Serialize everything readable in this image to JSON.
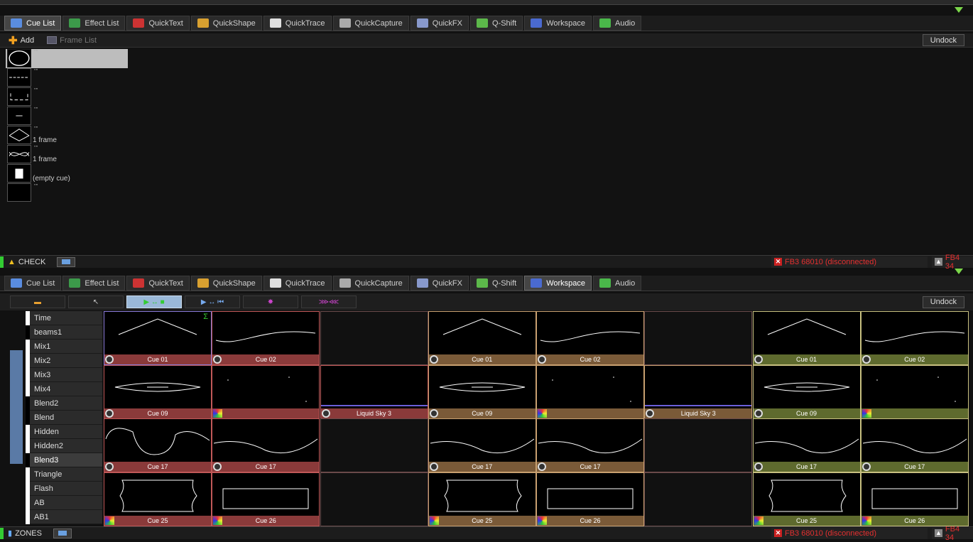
{
  "tabs": [
    {
      "label": "Cue List",
      "icon": "monitor-icon",
      "color": "#5a8de0"
    },
    {
      "label": "Effect List",
      "icon": "effect-list-icon",
      "color": "#3c9a4a"
    },
    {
      "label": "QuickText",
      "icon": "quicktext-icon",
      "color": "#cc3333"
    },
    {
      "label": "QuickShape",
      "icon": "quickshape-icon",
      "color": "#d8a030"
    },
    {
      "label": "QuickTrace",
      "icon": "quicktrace-icon",
      "color": "#e0e0e0"
    },
    {
      "label": "QuickCapture",
      "icon": "quickcapture-icon",
      "color": "#aaaaaa"
    },
    {
      "label": "QuickFX",
      "icon": "quickfx-icon",
      "color": "#8899cc"
    },
    {
      "label": "Q-Shift",
      "icon": "qshift-icon",
      "color": "#5cb84a"
    },
    {
      "label": "Workspace",
      "icon": "workspace-icon",
      "color": "#4a6ad0"
    },
    {
      "label": "Audio",
      "icon": "audio-icon",
      "color": "#4ab84a"
    }
  ],
  "top": {
    "active_tab": "Cue List",
    "toolbar": {
      "add": "Add",
      "frame_list": "Frame List",
      "undock": "Undock"
    },
    "cues": [
      {
        "label": "",
        "dots": "''''",
        "shape": "ellipse"
      },
      {
        "label": "",
        "dots": "''''",
        "shape": "dashes"
      },
      {
        "label": "",
        "dots": "''''",
        "shape": "bracket"
      },
      {
        "label": "",
        "dots": "''''",
        "shape": "minus"
      },
      {
        "label": "1 frame",
        "dots": "''''",
        "shape": "diamond"
      },
      {
        "label": "1 frame",
        "dots": "''''",
        "shape": "loop"
      },
      {
        "label": "(empty cue)",
        "dots": "",
        "shape": "doc"
      },
      {
        "label": "",
        "dots": "''''",
        "shape": "blank"
      }
    ],
    "status": {
      "check": "CHECK",
      "disconnected": "FB3 68010 (disconnected)",
      "fb4": "FB4 34"
    }
  },
  "bottom": {
    "active_tab": "Workspace",
    "undock": "Undock",
    "zones": [
      "Time",
      "beams1",
      "Mix1",
      "Mix2",
      "Mix3",
      "Mix4",
      "Blend2",
      "Blend",
      "Hidden",
      "Hidden2",
      "Blend3",
      "Triangle",
      "Flash",
      "AB",
      "AB1"
    ],
    "selected_zone": "Blend3",
    "status": {
      "zones": "ZONES",
      "disconnected": "FB3 68010 (disconnected)",
      "fb4": "FB4 34"
    },
    "group_colors": {
      "A": "#8a3a3a",
      "B": "#7a5a38",
      "C": "#5e6a2e"
    },
    "grid": [
      [
        {
          "label": "Cue 01",
          "g": "A",
          "s": "peak",
          "i": "disc",
          "sel": true
        },
        {
          "label": "Cue 02",
          "g": "A",
          "s": "wave",
          "i": "disc"
        },
        {
          "label": "",
          "g": "E"
        },
        {
          "label": "Cue 01",
          "g": "B",
          "s": "peak",
          "i": "disc"
        },
        {
          "label": "Cue 02",
          "g": "B",
          "s": "wave",
          "i": "disc"
        },
        {
          "label": "",
          "g": "E"
        },
        {
          "label": "Cue 01",
          "g": "C",
          "s": "peak",
          "i": "disc"
        },
        {
          "label": "Cue 02",
          "g": "C",
          "s": "wave",
          "i": "disc"
        }
      ],
      [
        {
          "label": "Cue 09",
          "g": "A",
          "s": "eye",
          "i": "disc"
        },
        {
          "label": "",
          "g": "A",
          "s": "dots",
          "i": "color"
        },
        {
          "label": "Liquid Sky 3",
          "g": "A",
          "s": "sky",
          "i": "disc"
        },
        {
          "label": "Cue 09",
          "g": "B",
          "s": "eye",
          "i": "disc"
        },
        {
          "label": "",
          "g": "B",
          "s": "dots",
          "i": "color"
        },
        {
          "label": "Liquid Sky 3",
          "g": "B",
          "s": "sky",
          "i": "disc"
        },
        {
          "label": "Cue 09",
          "g": "C",
          "s": "eye",
          "i": "disc"
        },
        {
          "label": "",
          "g": "C",
          "s": "dots",
          "i": "color"
        }
      ],
      [
        {
          "label": "Cue 17",
          "g": "A",
          "s": "dip",
          "i": "disc"
        },
        {
          "label": "Cue 17",
          "g": "A",
          "s": "curve",
          "i": "disc"
        },
        {
          "label": "",
          "g": "E"
        },
        {
          "label": "Cue 17",
          "g": "B",
          "s": "curve",
          "i": "disc"
        },
        {
          "label": "Cue 17",
          "g": "B",
          "s": "curve",
          "i": "disc"
        },
        {
          "label": "",
          "g": "E"
        },
        {
          "label": "Cue 17",
          "g": "C",
          "s": "curve",
          "i": "disc"
        },
        {
          "label": "Cue 17",
          "g": "C",
          "s": "curve",
          "i": "disc"
        }
      ],
      [
        {
          "label": "Cue 25",
          "g": "A",
          "s": "frame",
          "i": "color"
        },
        {
          "label": "Cue 26",
          "g": "A",
          "s": "rect",
          "i": "color"
        },
        {
          "label": "",
          "g": "E"
        },
        {
          "label": "Cue 25",
          "g": "B",
          "s": "frame",
          "i": "color"
        },
        {
          "label": "Cue 26",
          "g": "B",
          "s": "rect",
          "i": "color"
        },
        {
          "label": "",
          "g": "E"
        },
        {
          "label": "Cue 25",
          "g": "C",
          "s": "frame",
          "i": "color"
        },
        {
          "label": "Cue 26",
          "g": "C",
          "s": "rect",
          "i": "color"
        }
      ]
    ]
  }
}
